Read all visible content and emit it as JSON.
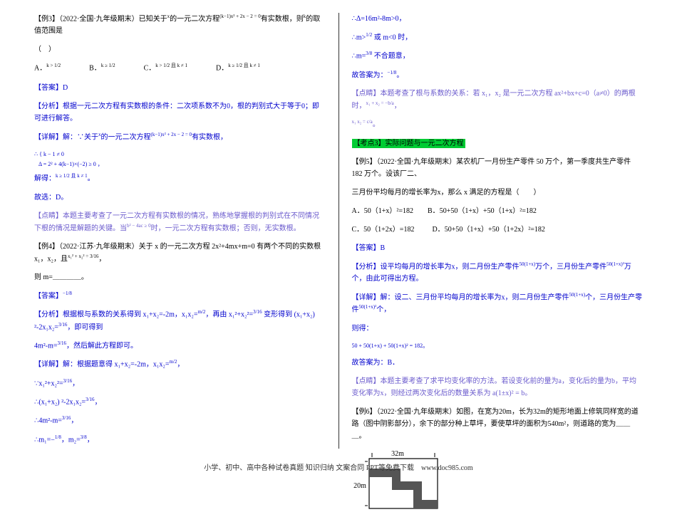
{
  "left": {
    "ex3_head": "【例3】（2022·全国·九年级期末）已知关于",
    "ex3_var": "x",
    "ex3_mid": "的一元二次方程",
    "ex3_eq": "(k−1)x² + 2x − 2 = 0",
    "ex3_tail": "有实数根，则",
    "ex3_var2": "k",
    "ex3_tail2": "的取值范围是",
    "paren_open": "（",
    "paren_close": "）",
    "choice_a_lbl": "A．",
    "choice_a": "k > 1/2",
    "choice_b_lbl": "B．",
    "choice_b": "k ≥ 1/2",
    "choice_c_lbl": "C．",
    "choice_c": "k > 1/2 且 k ≠ 1",
    "choice_d_lbl": "D．",
    "choice_d": "k ≥ 1/2 且 k ≠ 1",
    "ans3_lbl": "【答案】D",
    "ana3_lbl": "【分析】",
    "ana3": "根据一元二次方程有实数根的条件：二次项系数不为0，根的判别式大于等于0；即可进行解答。",
    "det3_lbl": "【详解】",
    "det3_a": "解：∵关于",
    "det3_b": "的一元二次方程",
    "det3_c": "有实数根，",
    "sys1": "k − 1 ≠ 0",
    "sys2": "Δ = 2² + 4(k−1)×(−2) ≥ 0",
    "sol3": "解得：",
    "sol3_eq": "k ≥ 1/2 且 k ≠ 1",
    "sol3_p": "。",
    "pick3": "故选：D。",
    "pt3_lbl": "【点睛】",
    "pt3": "本题主要考查了一元二次方程有实数根的情况，熟练地掌握根的判别式在不同情况下根的情况是解题的关键。当",
    "pt3_b": "b² − 4ac ≥ 0",
    "pt3_c": "时，一元二次方程有实数根；否则，无实数根。",
    "ex4_head": "【例4】（2022·江苏·九年级期末）关于 x 的一元二次方程 2x²+4mx+m=0 有两个不同的实数根 x₁，x₂，且",
    "ex4_eq": "x₁² + x₂² = 3/16",
    "ex4_comma": "，",
    "ex4_tail": "则 m=＿＿＿＿。",
    "ans4_lbl": "【答案】",
    "ans4": "−1/8",
    "ana4_lbl": "【分析】",
    "ana4_a": "根据根与系数的关系得到 x₁+x₂=-2m，x₁x₂=",
    "ana4_b": "m/2",
    "ana4_c": "，再由 x₁²+x₂²=",
    "ana4_d": "3/16",
    "ana4_e": " 变形得到 (x₁+x₂) ²-2x₁x₂=",
    "ana4_f": "3/16",
    "ana4_g": "，即可得到",
    "ana4_h": "4m²-m=",
    "ana4_i": "3/16",
    "ana4_j": "，然后解此方程即可。",
    "det4_lbl": "【详解】",
    "det4_a": "解：根据题意得 x₁+x₂=-2m，x₁x₂=",
    "det4_b": "m/2",
    "det4_c": "，",
    "line_a": "∵x₁²+x₂²=",
    "line_a2": "3/16",
    "line_a3": "，",
    "line_b": "∴(x₁+x₂) ²-2x₁x₂=",
    "line_b2": "3/16",
    "line_b3": "，",
    "line_c": "∴4m²-m=",
    "line_c2": "3/16",
    "line_c3": "，",
    "line_d": "∴m₁=−",
    "line_d2": "1/8",
    "line_d3": "，m₂=",
    "line_d4": "3/8",
    "line_d5": "，"
  },
  "right": {
    "r1": "∴Δ=16m²-8m>0，",
    "r2a": "∴m>",
    "r2b": "1/2",
    "r2c": " 或 m<0 时，",
    "r3a": "∴m=",
    "r3b": "3/8",
    "r3c": " 不合题意，",
    "r4a": "故答案为：",
    "r4b": "−1/8",
    "r4c": "。",
    "pt4_lbl": "【点睛】",
    "pt4_a": "本题考查了根与系数的关系：若 x₁，x₂ 是一元二次方程 ax²+bx+c=0（a≠0）的两根时，",
    "pt4_b": "x₁ + x₂ = −b/a",
    "pt4_c": "，",
    "pt4_d": "x₁ x₂ = c/a",
    "pt4_e": "。",
    "topic3": "【考点3】实际问题与一元二次方程",
    "ex5_head": "【例5】（2022·全国·九年级期末）某农机厂一月份生产零件 50 万个，第一季度共生产零件 182 万个。设该厂二、",
    "ex5_tail": "三月份平均每月的增长率为x，那么 x 满足的方程是（　　）",
    "c5a_lbl": "A．",
    "c5a": "50（1+x）²=182",
    "c5b_lbl": "B．",
    "c5b": "50+50（1+x）+50（1+x）²=182",
    "c5c_lbl": "C．",
    "c5c": "50（1+2x）=182",
    "c5d_lbl": "D．",
    "c5d": "50+50（1+x）+50（1+2x）²=182",
    "ans5_lbl": "【答案】B",
    "ana5_lbl": "【分析】",
    "ana5_a": "设平均每月的增长率为x，则二月份生产零件",
    "ana5_b": "50(1+x)",
    "ana5_c": "万个，三月份生产零件",
    "ana5_d": "50(1+x)²",
    "ana5_e": "万个，由此可得出方程。",
    "det5_lbl": "【详解】",
    "det5_a": "解：设二、三月份平均每月的增长率为x，则二月份生产零件",
    "det5_b": "50(1+x)",
    "det5_c": "个，三月份生产零件",
    "det5_d": "50(1+x)²",
    "det5_e": "个，",
    "det5_f": "则得：",
    "eq5": "50 + 50(1+x) + 50(1+x)² = 182",
    "eq5_p": "。",
    "pick5": "故答案为：B．",
    "pt5_lbl": "【点睛】",
    "pt5": "本题主要考查了求平均变化率的方法。若设变化前的量为a，变化后的量为b，平均变化率为x，则经过两次变化后的数量关系为 a(1±x)² = b。",
    "ex6_head": "【例6】（2022·全国·九年级期末）如图，在宽为20m，长为32m的矩形地面上修筑同样宽的道路（图中阴影部分），余下的部分种上草坪，要使草坪的面积为540m²，则道路的宽为＿＿＿。",
    "diag_w": "32m",
    "diag_h": "20m"
  },
  "footer": "小学、初中、高中各种试卷真题 知识归纳 文案合同 PPT等免费下载　www.doc985.com"
}
